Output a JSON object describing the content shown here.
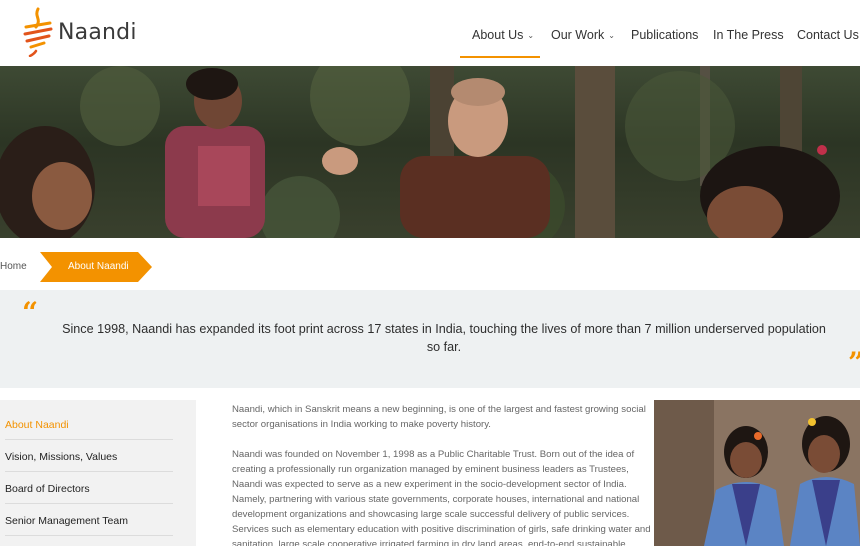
{
  "brand": {
    "name": "Naandi",
    "accent": "#f39200"
  },
  "nav": {
    "items": [
      {
        "label": "About Us",
        "has_dropdown": true,
        "active": true
      },
      {
        "label": "Our Work",
        "has_dropdown": true,
        "active": false
      },
      {
        "label": "Publications",
        "has_dropdown": false,
        "active": false
      },
      {
        "label": "In The Press",
        "has_dropdown": false,
        "active": false
      },
      {
        "label": "Contact Us",
        "has_dropdown": false,
        "active": false
      }
    ],
    "dropdown_icon": "chevron-down-icon"
  },
  "breadcrumb": {
    "home": "Home",
    "current": "About Naandi"
  },
  "quote": {
    "text": "Since 1998, Naandi has expanded its foot print across 17 states in India, touching the lives of more than 7 million underserved population so far.",
    "open_mark": "“",
    "close_mark": "”"
  },
  "sidebar": {
    "items": [
      {
        "label": "About Naandi",
        "active": true
      },
      {
        "label": "Vision, Missions, Values",
        "active": false
      },
      {
        "label": "Board of Directors",
        "active": false
      },
      {
        "label": "Senior Management Team",
        "active": false
      }
    ]
  },
  "content": {
    "paragraphs": [
      "Naandi, which in Sanskrit means a new beginning, is one of the largest and fastest growing social sector organisations in India working to make poverty history.",
      "Naandi was founded on November 1, 1998 as a Public Charitable Trust. Born out of the idea of creating a professionally run organization managed by eminent business leaders as Trustees, Naandi was expected to serve as a new experiment in the socio-development sector of India. Namely, partnering with various state governments, corporate houses, international and national development organizations and showcasing large scale successful delivery of public services. Services such as elementary education with positive discrimination of girls, safe drinking water and sanitation, large scale cooperative irrigated farming in dry land areas, end-to-end sustainable"
    ]
  }
}
